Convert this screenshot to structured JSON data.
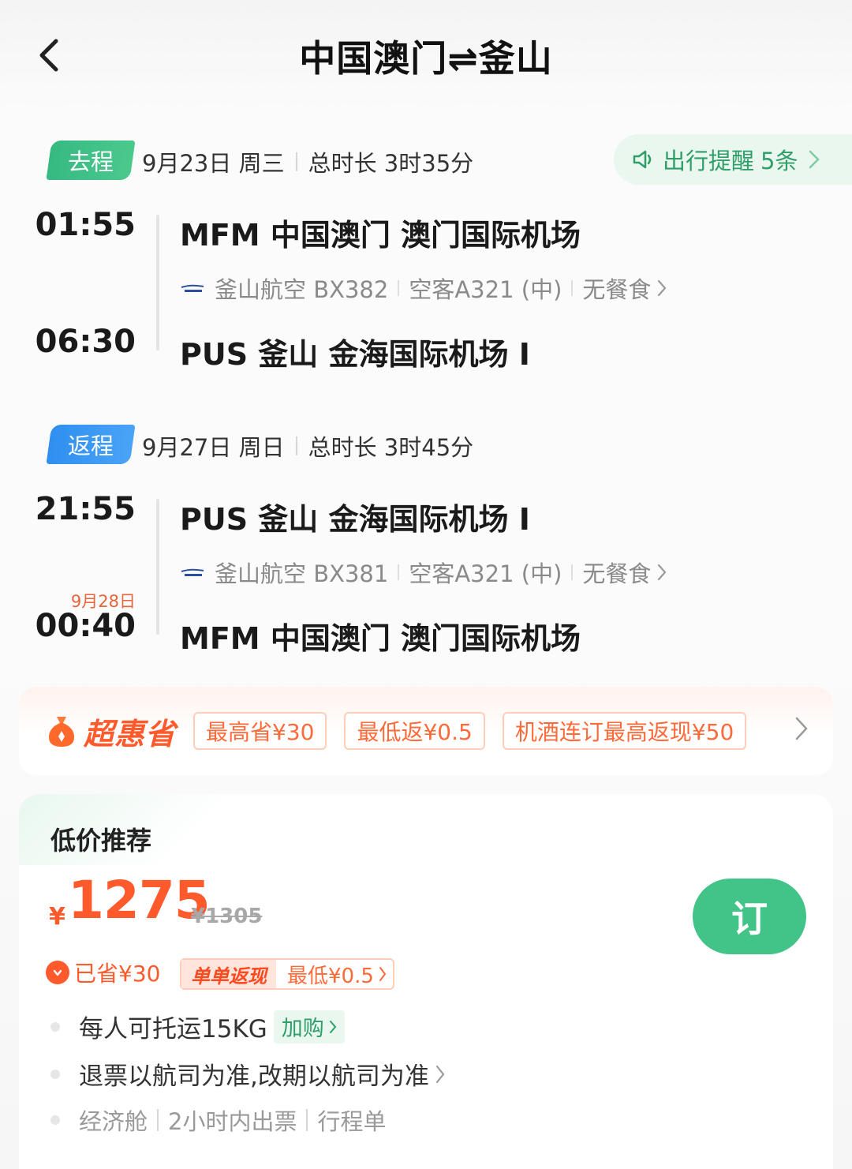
{
  "header": {
    "title": "中国澳门⇌釜山",
    "back_icon": "chevron-left-icon"
  },
  "reminder": {
    "label": "出行提醒",
    "count": "5条"
  },
  "outbound": {
    "tag": "去程",
    "date": "9月23日 周三",
    "duration": "总时长 3时35分",
    "depart_time": "01:55",
    "arrive_time": "06:30",
    "depart_airport": "MFM 中国澳门 澳门国际机场",
    "arrive_airport": "PUS 釜山 金海国际机场 I",
    "airline": "釜山航空 BX382",
    "aircraft": "空客A321 (中)",
    "meal": "无餐食"
  },
  "inbound": {
    "tag": "返程",
    "date": "9月27日 周日",
    "duration": "总时长 3时45分",
    "depart_time": "21:55",
    "arrive_date": "9月28日",
    "arrive_time": "00:40",
    "depart_airport": "PUS 釜山 金海国际机场 I",
    "arrive_airport": "MFM 中国澳门 澳门国际机场",
    "airline": "釜山航空 BX381",
    "aircraft": "空客A321 (中)",
    "meal": "无餐食"
  },
  "promo": {
    "brand": "超惠省",
    "chips": [
      "最高省¥30",
      "最低返¥0.5",
      "机酒连订最高返现¥50"
    ]
  },
  "offer": {
    "section_title": "低价推荐",
    "currency": "¥",
    "price": "1275",
    "original_price": "¥1305",
    "book_label": "订",
    "saved": "已省¥30",
    "cashback_label": "单单返现",
    "cashback_value": "最低¥0.5",
    "baggage": "每人可托运15KG",
    "addon": "加购",
    "refund_policy": "退票以航司为准,改期以航司为准",
    "cabin": "经济舱",
    "ticketing": "2小时内出票",
    "itinerary": "行程单"
  },
  "colors": {
    "accent_green": "#42c387",
    "accent_orange": "#ff5a2c",
    "accent_blue": "#2f8ff0"
  }
}
